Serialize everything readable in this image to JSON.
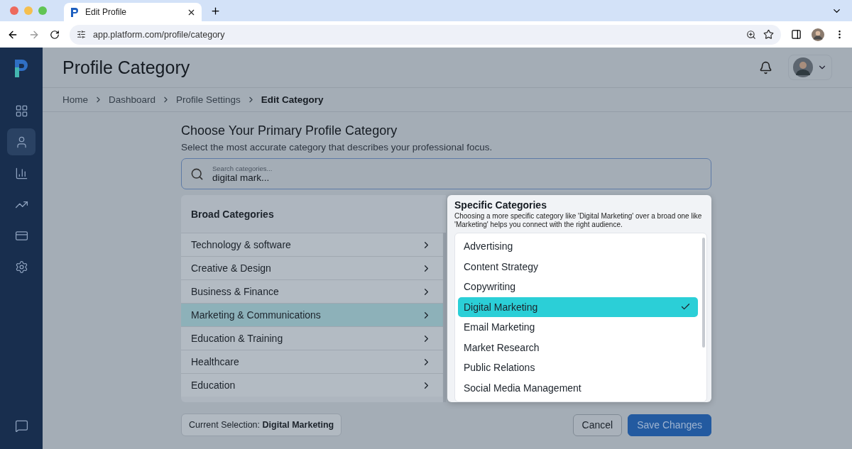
{
  "browser": {
    "tab_title": "Edit Profile",
    "url": "app.platform.com/profile/category"
  },
  "sidebar": {
    "items": [
      {
        "kind": "dashboard",
        "selected": false
      },
      {
        "kind": "profile",
        "selected": true
      },
      {
        "kind": "analytics",
        "selected": false
      },
      {
        "kind": "trends",
        "selected": false
      },
      {
        "kind": "billing",
        "selected": false
      },
      {
        "kind": "settings",
        "selected": false
      }
    ],
    "footer_item": {
      "kind": "help",
      "selected": false
    }
  },
  "header": {
    "title": "Profile Category"
  },
  "breadcrumb": [
    {
      "label": "Home",
      "current": false
    },
    {
      "label": "Dashboard",
      "current": false
    },
    {
      "label": "Profile Settings",
      "current": false
    },
    {
      "label": "Edit Category",
      "current": true
    }
  ],
  "section": {
    "title": "Choose Your Primary Profile Category",
    "subtitle": "Select the most accurate category that describes your professional focus."
  },
  "search": {
    "placeholder": "Search categories...",
    "value": "digital mark..."
  },
  "broad": {
    "heading": "Broad Categories",
    "items": [
      {
        "label": "Technology & software",
        "selected": false
      },
      {
        "label": "Creative & Design",
        "selected": false
      },
      {
        "label": "Business & Finance",
        "selected": false
      },
      {
        "label": "Marketing & Communications",
        "selected": true
      },
      {
        "label": "Education & Training",
        "selected": false
      },
      {
        "label": "Healthcare",
        "selected": false
      },
      {
        "label": "Education",
        "selected": false
      }
    ]
  },
  "specific": {
    "heading": "Specific Categories",
    "description": "Choosing a more specific category like 'Digital Marketing' over a broad one like 'Marketing' helps you connect with the right audience.",
    "items": [
      {
        "label": "Advertising",
        "selected": false
      },
      {
        "label": "Content Strategy",
        "selected": false
      },
      {
        "label": "Copywriting",
        "selected": false
      },
      {
        "label": "Digital Marketing",
        "selected": true
      },
      {
        "label": "Email Marketing",
        "selected": false
      },
      {
        "label": "Market Research",
        "selected": false
      },
      {
        "label": "Public Relations",
        "selected": false
      },
      {
        "label": "Social Media Management",
        "selected": false
      }
    ]
  },
  "footer": {
    "current_selection": "Current Selection: **Digital Marketing**",
    "cancel": "Cancel",
    "save": "Save Changes"
  }
}
